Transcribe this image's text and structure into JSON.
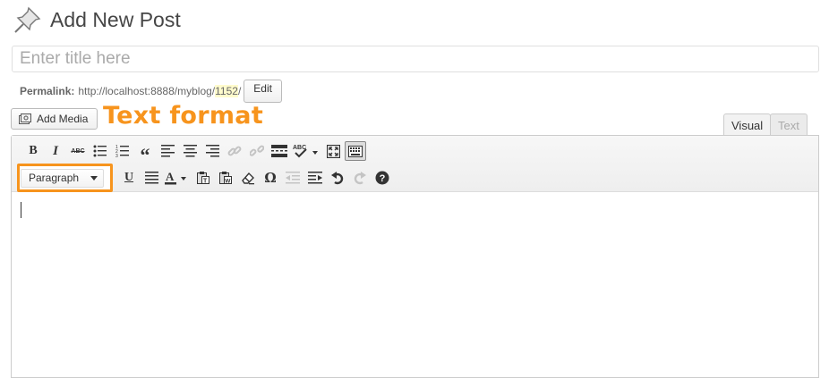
{
  "header": {
    "title": "Add New Post",
    "icon": "pushpin-icon"
  },
  "title_field": {
    "placeholder": "Enter title here",
    "value": ""
  },
  "permalink": {
    "label": "Permalink:",
    "url_prefix": "http://localhost:8888/myblog/",
    "slug": "1152",
    "url_suffix": "/",
    "edit_label": "Edit"
  },
  "media": {
    "add_media_label": "Add Media"
  },
  "annotation": {
    "text": "Text format",
    "color": "#f7941d"
  },
  "tabs": [
    {
      "label": "Visual",
      "active": true
    },
    {
      "label": "Text",
      "active": false
    }
  ],
  "toolbar": {
    "row1": [
      {
        "name": "bold",
        "glyph": "B"
      },
      {
        "name": "italic",
        "glyph": "I"
      },
      {
        "name": "strikethrough",
        "glyph": "ABC"
      },
      {
        "name": "bulleted-list",
        "glyph": "bullets"
      },
      {
        "name": "numbered-list",
        "glyph": "numbers"
      },
      {
        "name": "blockquote",
        "glyph": "“"
      },
      {
        "name": "align-left",
        "glyph": "align-left"
      },
      {
        "name": "align-center",
        "glyph": "align-center"
      },
      {
        "name": "align-right",
        "glyph": "align-right"
      },
      {
        "name": "insert-link",
        "glyph": "link",
        "disabled": true
      },
      {
        "name": "remove-link",
        "glyph": "unlink",
        "disabled": true
      },
      {
        "name": "read-more",
        "glyph": "more"
      },
      {
        "name": "spellcheck",
        "glyph": "ABC✓"
      },
      {
        "name": "fullscreen",
        "glyph": "fullscreen"
      },
      {
        "name": "kitchen-sink",
        "glyph": "keyboard",
        "active": true
      }
    ],
    "format_select": {
      "value": "Paragraph",
      "options": [
        "Paragraph"
      ]
    },
    "row2": [
      {
        "name": "underline",
        "glyph": "U"
      },
      {
        "name": "justify",
        "glyph": "justify"
      },
      {
        "name": "text-color",
        "glyph": "A"
      },
      {
        "name": "paste-text",
        "glyph": "paste-text"
      },
      {
        "name": "paste-word",
        "glyph": "paste-word"
      },
      {
        "name": "clear-formatting",
        "glyph": "eraser"
      },
      {
        "name": "special-character",
        "glyph": "Ω"
      },
      {
        "name": "outdent",
        "glyph": "outdent",
        "disabled": true
      },
      {
        "name": "indent",
        "glyph": "indent"
      },
      {
        "name": "undo",
        "glyph": "undo"
      },
      {
        "name": "redo",
        "glyph": "redo",
        "disabled": true
      },
      {
        "name": "help",
        "glyph": "?"
      }
    ]
  },
  "editor": {
    "content": ""
  }
}
